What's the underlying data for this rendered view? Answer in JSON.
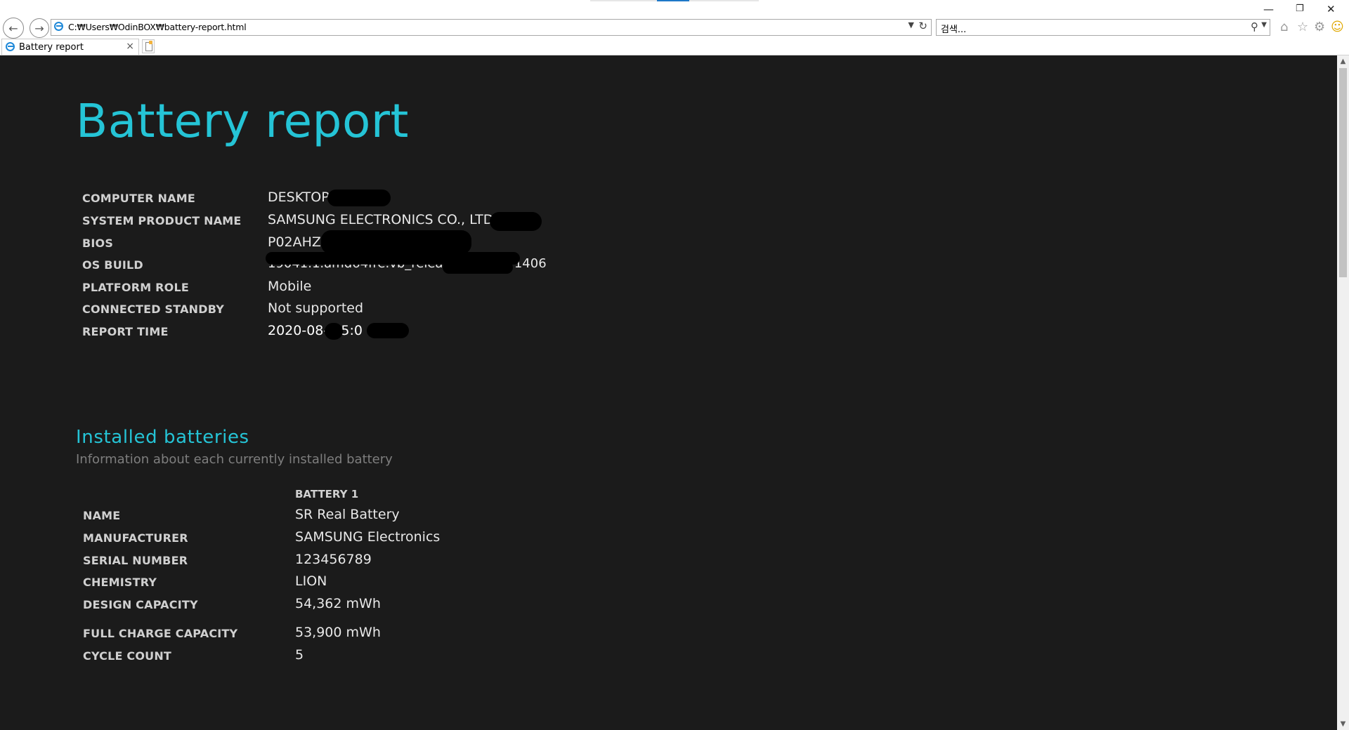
{
  "browser": {
    "url": "C:₩Users₩OdinBOX₩battery-report.html",
    "search_placeholder": "검색...",
    "tab_title": "Battery report",
    "icons": {
      "back": "back-arrow-icon",
      "forward": "forward-arrow-icon",
      "refresh": "refresh-icon",
      "home": "home-icon",
      "favorites": "star-icon",
      "settings": "gear-icon",
      "feedback": "smiley-icon"
    }
  },
  "report": {
    "title": "Battery report",
    "system_info": [
      {
        "label": "COMPUTER NAME",
        "value": "DESKTOP-"
      },
      {
        "label": "SYSTEM PRODUCT NAME",
        "value": "SAMSUNG ELECTRONICS CO., LTD."
      },
      {
        "label": "BIOS",
        "value": "P02AHZ."
      },
      {
        "label": "OS BUILD",
        "value": "19041.1.amd64fre.vb_release.191206-1406"
      },
      {
        "label": "PLATFORM ROLE",
        "value": "Mobile"
      },
      {
        "label": "CONNECTED STANDBY",
        "value": "Not supported"
      },
      {
        "label": "REPORT TIME",
        "value": "2020-08-   15:0"
      }
    ],
    "installed": {
      "title": "Installed batteries",
      "subtitle": "Information about each currently installed battery",
      "column_header": "BATTERY 1",
      "rows": [
        {
          "label": "NAME",
          "value": "SR Real Battery"
        },
        {
          "label": "MANUFACTURER",
          "value": "SAMSUNG Electronics"
        },
        {
          "label": "SERIAL NUMBER",
          "value": "123456789"
        },
        {
          "label": "CHEMISTRY",
          "value": "LION"
        },
        {
          "label": "DESIGN CAPACITY",
          "value": "54,362 mWh"
        },
        {
          "label": "FULL CHARGE CAPACITY",
          "value": "53,900 mWh"
        },
        {
          "label": "CYCLE COUNT",
          "value": "5"
        }
      ]
    }
  },
  "colors": {
    "accent": "#25c4d6",
    "background": "#1b1b1b",
    "label": "#d0d0d0",
    "value": "#e8e8e8",
    "muted": "#7e7e7e"
  }
}
